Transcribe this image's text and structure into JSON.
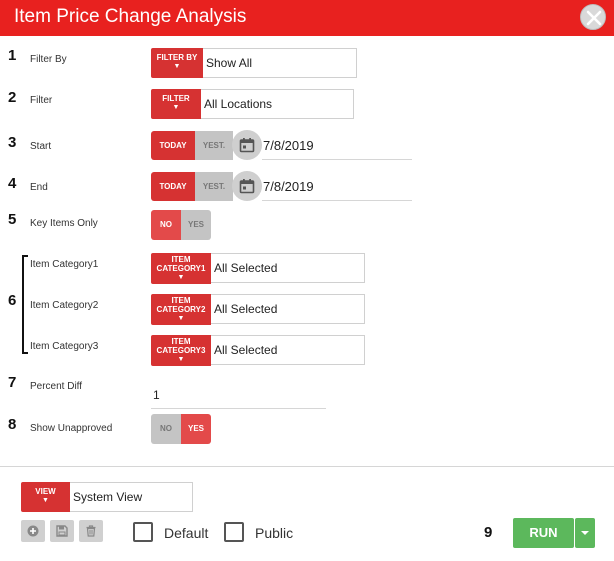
{
  "window": {
    "title": "Item Price Change Analysis",
    "close_icon": "close-x-icon"
  },
  "steps": [
    "1",
    "2",
    "3",
    "4",
    "5",
    "6",
    "7",
    "8",
    "9"
  ],
  "filter_by": {
    "label": "Filter By",
    "button": "FILTER BY",
    "value": "Show All"
  },
  "filter": {
    "label": "Filter",
    "button": "FILTER",
    "value": "All Locations"
  },
  "start": {
    "label": "Start",
    "today": "TODAY",
    "yesterday": "YEST.",
    "value": "7/8/2019"
  },
  "end": {
    "label": "End",
    "today": "TODAY",
    "yesterday": "YEST.",
    "value": "7/8/2019"
  },
  "key_items": {
    "label": "Key Items Only",
    "no": "NO",
    "yes": "YES",
    "selected": "NO"
  },
  "categories": [
    {
      "label": "Item Category1",
      "button_line1": "ITEM",
      "button_line2": "CATEGORY1",
      "value": "All Selected"
    },
    {
      "label": "Item Category2",
      "button_line1": "ITEM",
      "button_line2": "CATEGORY2",
      "value": "All Selected"
    },
    {
      "label": "Item Category3",
      "button_line1": "ITEM",
      "button_line2": "CATEGORY3",
      "value": "All Selected"
    }
  ],
  "percent_diff": {
    "label": "Percent Diff",
    "value": "1"
  },
  "show_unapproved": {
    "label": "Show Unapproved",
    "no": "NO",
    "yes": "YES",
    "selected": "YES"
  },
  "view": {
    "button": "VIEW",
    "value": "System View"
  },
  "footer": {
    "default_label": "Default",
    "public_label": "Public",
    "run_label": "RUN",
    "icons": [
      "add-icon",
      "save-icon",
      "delete-icon"
    ]
  },
  "colors": {
    "header": "#e8211f",
    "accent": "#d63232",
    "run": "#5cb85c"
  }
}
